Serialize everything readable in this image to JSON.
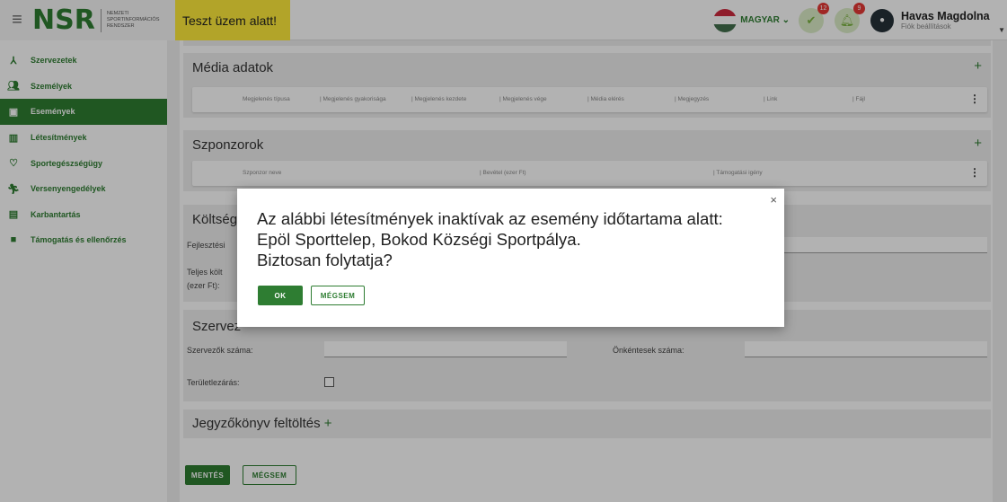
{
  "header": {
    "logo": "NSR",
    "logo_sub": [
      "NEMZETI",
      "SPORTINFORMÁCIÓS",
      "RENDSZER"
    ],
    "test_banner": "Teszt üzem alatt!",
    "language": "MAGYAR",
    "tasks_badge": "12",
    "notifications_badge": "9",
    "user_name": "Havas Magdolna",
    "account_settings": "Fiók beállítások"
  },
  "sidebar": {
    "items": [
      {
        "label": "Szervezetek",
        "icon": "organization-icon"
      },
      {
        "label": "Személyek",
        "icon": "people-icon"
      },
      {
        "label": "Események",
        "icon": "calendar-icon"
      },
      {
        "label": "Létesítmények",
        "icon": "building-icon"
      },
      {
        "label": "Sportegészségügy",
        "icon": "heart-icon"
      },
      {
        "label": "Versenyengedélyek",
        "icon": "runner-icon"
      },
      {
        "label": "Karbantartás",
        "icon": "clipboard-icon"
      },
      {
        "label": "Támogatás és ellenőrzés",
        "icon": "briefcase-icon"
      }
    ],
    "active_index": 2
  },
  "media": {
    "title": "Média adatok",
    "columns": [
      "Megjelenés típusa",
      "| Megjelenés gyakorisága",
      "| Megjelenés kezdete",
      "| Megjelenés vége",
      "| Média elérés",
      "| Megjegyzés",
      "| Link",
      "| Fájl"
    ]
  },
  "sponsors": {
    "title": "Szponzorok",
    "columns": [
      "Szponzor neve",
      "| Bevétel (ezer Ft)",
      "| Támogatási igény"
    ]
  },
  "costs": {
    "title": "Költség",
    "dev_label": "Fejlesztési",
    "total_label_1": "Teljes költ",
    "total_label_2": "(ezer Ft):"
  },
  "organizers": {
    "title": "Szervez",
    "organizers_count_label": "Szervezők száma:",
    "volunteers_count_label": "Önkéntesek száma:",
    "area_closure_label": "Területlezárás:"
  },
  "minutes": {
    "title": "Jegyzőkönyv feltöltés",
    "plus": "+"
  },
  "footer_buttons": {
    "save": "MENTÉS",
    "cancel": "MÉGSEM"
  },
  "dialog": {
    "line1": "Az alábbi létesítmények inaktívak az esemény időtartama alatt:",
    "line2": "Epöl Sporttelep, Bokod Községi Sportpálya.",
    "line3": "Biztosan folytatja?",
    "ok": "OK",
    "cancel": "MÉGSEM",
    "close": "×"
  },
  "colors": {
    "brand_green": "#2e7d32",
    "test_banner": "#ffeb3b",
    "badge_red": "#e53935"
  }
}
